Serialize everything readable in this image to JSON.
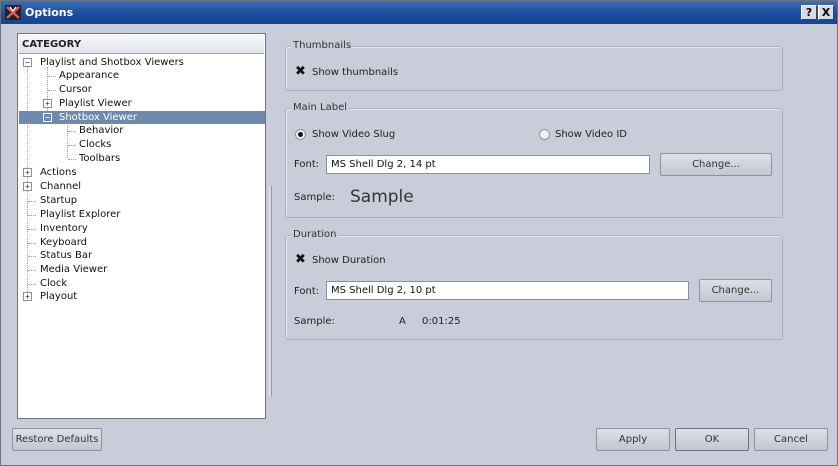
{
  "window": {
    "title": "Options",
    "help_label": "?",
    "close_label": "X"
  },
  "category": {
    "header": "CATEGORY",
    "items": [
      {
        "label": "Playlist and Shotbox Viewers",
        "expander": "−"
      },
      {
        "label": "Appearance"
      },
      {
        "label": "Cursor"
      },
      {
        "label": "Playlist Viewer",
        "expander": "+"
      },
      {
        "label": "Shotbox Viewer",
        "expander": "−",
        "selected": true
      },
      {
        "label": "Behavior"
      },
      {
        "label": "Clocks"
      },
      {
        "label": "Toolbars"
      },
      {
        "label": "Actions",
        "expander": "+"
      },
      {
        "label": "Channel",
        "expander": "+"
      },
      {
        "label": "Startup"
      },
      {
        "label": "Playlist Explorer"
      },
      {
        "label": "Inventory"
      },
      {
        "label": "Keyboard"
      },
      {
        "label": "Status Bar"
      },
      {
        "label": "Media Viewer"
      },
      {
        "label": "Clock"
      },
      {
        "label": "Playout",
        "expander": "+"
      }
    ]
  },
  "thumbnails": {
    "title": "Thumbnails",
    "show_label": "Show thumbnails",
    "checked": true
  },
  "main_label": {
    "title": "Main Label",
    "radio_slug": "Show Video Slug",
    "radio_id": "Show Video ID",
    "selected": "Show Video Slug",
    "font_label": "Font:",
    "font_value": "MS Shell Dlg 2, 14 pt",
    "change_button": "Change...",
    "sample_label": "Sample:",
    "sample_text": "Sample"
  },
  "duration": {
    "title": "Duration",
    "show_label": "Show Duration",
    "checked": true,
    "font_label": "Font:",
    "font_value": "MS Shell Dlg 2, 10 pt",
    "change_button": "Change...",
    "sample_label": "Sample:",
    "sample_a": "A",
    "sample_time": "0:01:25"
  },
  "footer": {
    "restore_defaults": "Restore Defaults",
    "apply": "Apply",
    "ok": "OK",
    "cancel": "Cancel"
  },
  "icons": {
    "check": "✖",
    "app": "app-logo-icon"
  }
}
